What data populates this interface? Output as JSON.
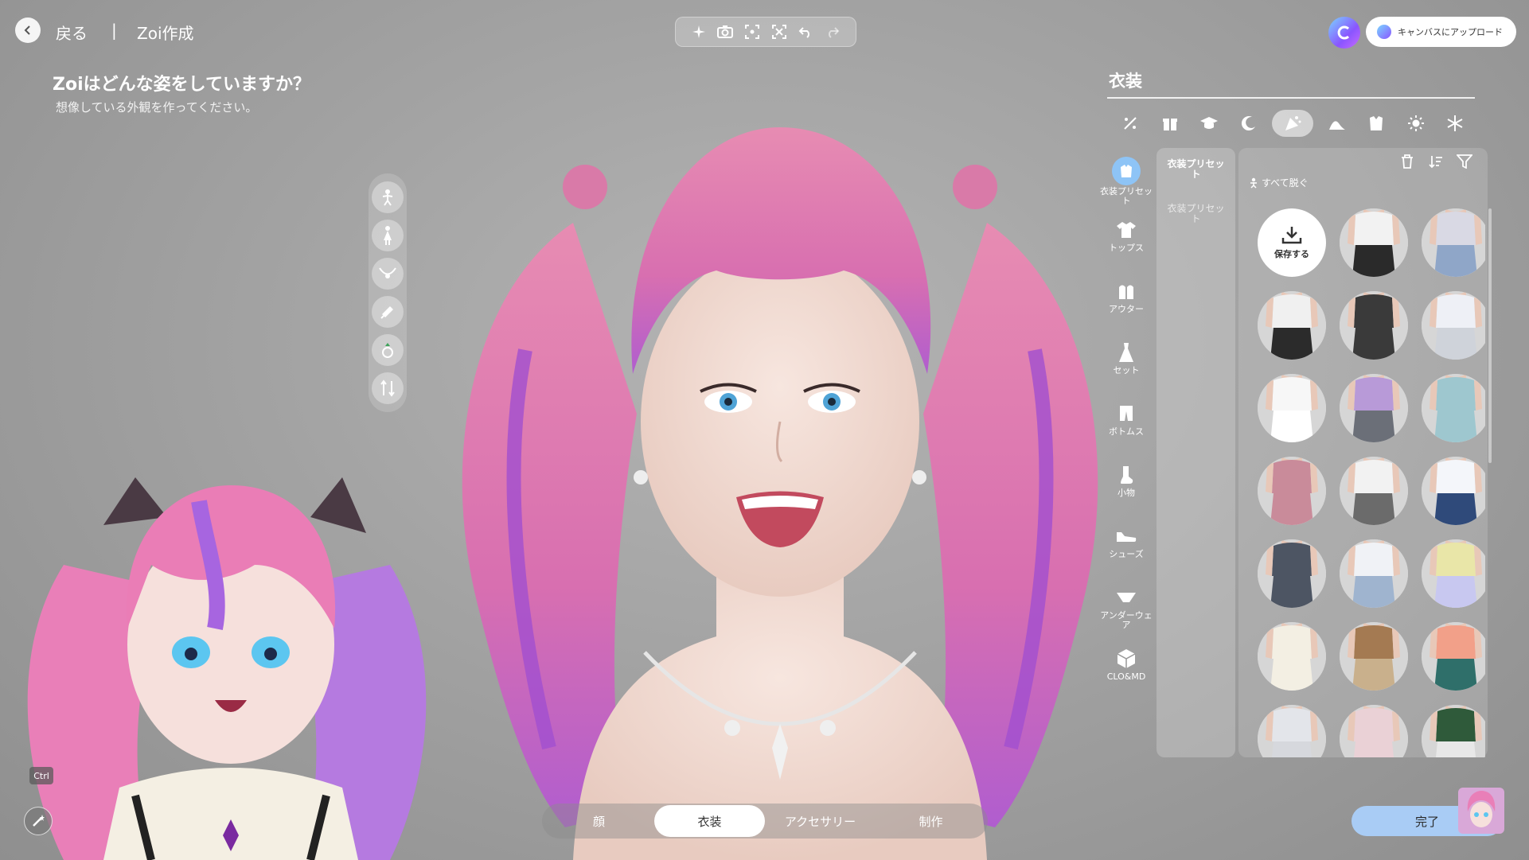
{
  "header": {
    "back_label": "戻る",
    "separator": "|",
    "title": "Zoi作成"
  },
  "toolbar": {
    "icons": [
      "sparkle-icon",
      "camera-icon",
      "focus-icon",
      "fit-icon",
      "undo-icon",
      "redo-icon"
    ]
  },
  "upload": {
    "label": "キャンバスにアップロード"
  },
  "intro": {
    "question": "Zoiはどんな姿をしていますか？",
    "subtext": "想像している外観を作ってください。"
  },
  "left_tools": [
    "body-pose-icon",
    "figure-icon",
    "necklace-icon",
    "hand-icon",
    "ring-icon",
    "arrows-icon"
  ],
  "panel": {
    "title": "衣装",
    "categories": [
      "all-icon",
      "gift-icon",
      "graduation-cap-icon",
      "moon-icon",
      "party-icon",
      "wave-icon",
      "fashion-icon",
      "sun-icon",
      "snowflake-icon"
    ],
    "active_category": 4,
    "nav": [
      {
        "label": "衣装プリセット",
        "icon": "preset-icon",
        "active": true
      },
      {
        "label": "トップス",
        "icon": "tshirt-icon",
        "active": false
      },
      {
        "label": "アウター",
        "icon": "jacket-icon",
        "active": false
      },
      {
        "label": "セット",
        "icon": "dress-icon",
        "active": false
      },
      {
        "label": "ボトムス",
        "icon": "pants-icon",
        "active": false
      },
      {
        "label": "小物",
        "icon": "sock-icon",
        "active": false
      },
      {
        "label": "シューズ",
        "icon": "shoe-icon",
        "active": false
      },
      {
        "label": "アンダーウェア",
        "icon": "underwear-icon",
        "active": false
      },
      {
        "label": "CLO&MD",
        "icon": "cube-icon",
        "active": false
      }
    ],
    "sub_active": "衣装プリセット",
    "sub_inactive": "衣装プリセット",
    "undress_label": "すべて脱ぐ",
    "save_label": "保存する",
    "items": [
      {
        "top": "#f2f2f2",
        "bottom": "#2a2a2a",
        "skin": "#e8c8b8"
      },
      {
        "top": "#d9d9e4",
        "bottom": "#8fa6c8",
        "skin": "#e8c8b8"
      },
      {
        "top": "#f0f0f0",
        "bottom": "#2b2b2b",
        "skin": "#e8c8b8"
      },
      {
        "top": "#3a3a3a",
        "bottom": "#3a3a3a",
        "skin": "#e8c8b8"
      },
      {
        "top": "#eef0f6",
        "bottom": "#cfd3da",
        "skin": "#e8c8b8"
      },
      {
        "top": "#f7f7f7",
        "bottom": "#ffffff",
        "skin": "#e8c8b8"
      },
      {
        "top": "#b89ad8",
        "bottom": "#6b6f78",
        "skin": "#e8c8b8"
      },
      {
        "top": "#9ec7cf",
        "bottom": "#9ec7cf",
        "skin": "#e8c8b8"
      },
      {
        "top": "#c98b9a",
        "bottom": "#c98b9a",
        "skin": "#e8c8b8"
      },
      {
        "top": "#f2f2f2",
        "bottom": "#6b6b6b",
        "skin": "#e8c8b8"
      },
      {
        "top": "#f4f6fa",
        "bottom": "#2f4a7a",
        "skin": "#e8c8b8"
      },
      {
        "top": "#4d5563",
        "bottom": "#4d5563",
        "skin": "#e8c8b8"
      },
      {
        "top": "#f0f2f6",
        "bottom": "#9fb4cf",
        "skin": "#e8c8b8"
      },
      {
        "top": "#e9e6a8",
        "bottom": "#c8c8f0",
        "skin": "#e8c8b8"
      },
      {
        "top": "#f3efe3",
        "bottom": "#f3efe3",
        "skin": "#e8c8b8"
      },
      {
        "top": "#a47a52",
        "bottom": "#c9b08c",
        "skin": "#e8c8b8"
      },
      {
        "top": "#f2a089",
        "bottom": "#2f6f6a",
        "skin": "#e8c8b8"
      },
      {
        "top": "#e3e5ea",
        "bottom": "#d6d8dd",
        "skin": "#e8c8b8"
      },
      {
        "top": "#ead1d6",
        "bottom": "#ead1d6",
        "skin": "#e8c8b8"
      },
      {
        "top": "#2f5a3a",
        "bottom": "#e8e8e8",
        "skin": "#e8c8b8"
      }
    ]
  },
  "bottom_tabs": [
    {
      "label": "顔",
      "active": false
    },
    {
      "label": "衣装",
      "active": true
    },
    {
      "label": "アクセサリー",
      "active": false
    },
    {
      "label": "制作",
      "active": false
    }
  ],
  "done_label": "完了",
  "key_hint": "Ctrl",
  "colors": {
    "hair_pink": "#e98ab4",
    "hair_purple": "#a457d6",
    "accent_blue": "#a9ccf5",
    "skin": "#f1dcd3"
  }
}
